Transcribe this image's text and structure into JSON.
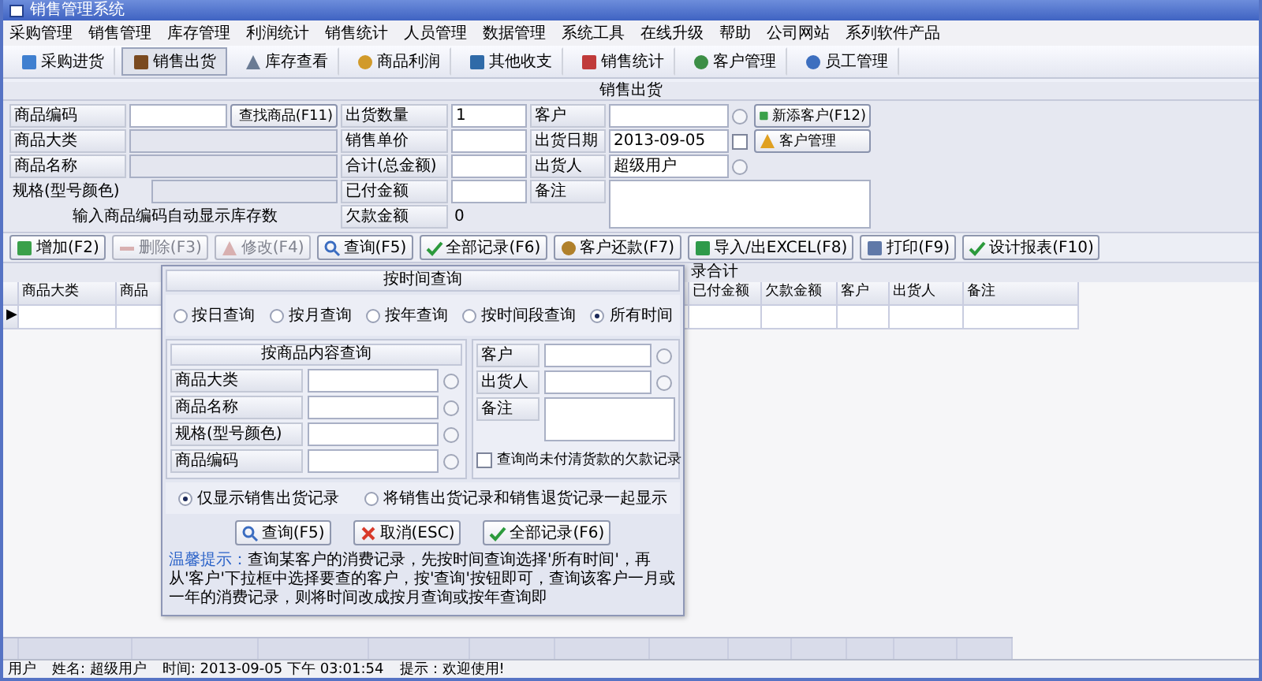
{
  "window": {
    "title": "销售管理系统"
  },
  "menu": [
    "采购管理",
    "销售管理",
    "库存管理",
    "利润统计",
    "销售统计",
    "人员管理",
    "数据管理",
    "系统工具",
    "在线升级",
    "帮助",
    "公司网站",
    "系列软件产品"
  ],
  "toolbar": [
    {
      "label": "采购进货",
      "selected": false
    },
    {
      "label": "销售出货",
      "selected": true
    },
    {
      "label": "库存查看",
      "selected": false
    },
    {
      "label": "商品利润",
      "selected": false
    },
    {
      "label": "其他收支",
      "selected": false
    },
    {
      "label": "销售统计",
      "selected": false
    },
    {
      "label": "客户管理",
      "selected": false
    },
    {
      "label": "员工管理",
      "selected": false
    }
  ],
  "section_title": "销售出货",
  "form": {
    "code_label": "商品编码",
    "find_button": "查找商品(F11)",
    "category_label": "商品大类",
    "name_label": "商品名称",
    "spec_label": "规格(型号颜色)",
    "stock_hint": "输入商品编码自动显示库存数",
    "qty_label": "出货数量",
    "qty_value": "1",
    "price_label": "销售单价",
    "total_label": "合计(总金额)",
    "paid_label": "已付金额",
    "owed_label": "欠款金额",
    "owed_value": "0",
    "customer_label": "客户",
    "date_label": "出货日期",
    "date_value": "2013-09-05",
    "date_checked": false,
    "seller_label": "出货人",
    "seller_value": "超级用户",
    "note_label": "备注",
    "new_customer_button": "新添客户(F12)",
    "customer_manage_button": "客户管理"
  },
  "actions": [
    {
      "label": "增加(F2)",
      "disabled": false
    },
    {
      "label": "删除(F3)",
      "disabled": true
    },
    {
      "label": "修改(F4)",
      "disabled": true
    },
    {
      "label": "查询(F5)",
      "disabled": false
    },
    {
      "label": "全部记录(F6)",
      "disabled": false
    },
    {
      "label": "客户还款(F7)",
      "disabled": false
    },
    {
      "label": "导入/出EXCEL(F8)",
      "disabled": false
    },
    {
      "label": "打印(F9)",
      "disabled": false
    },
    {
      "label": "设计报表(F10)",
      "disabled": false
    }
  ],
  "grid": {
    "caption": "录合计",
    "current_row_marker": "▶",
    "columns": [
      "商品大类",
      "商品",
      "已付金额",
      "欠款金额",
      "客户",
      "出货人",
      "备注"
    ]
  },
  "dialog": {
    "time_title": "按时间查询",
    "time_options": [
      {
        "label": "按日查询",
        "selected": false
      },
      {
        "label": "按月查询",
        "selected": false
      },
      {
        "label": "按年查询",
        "selected": false
      },
      {
        "label": "按时间段查询",
        "selected": false
      },
      {
        "label": "所有时间",
        "selected": true
      }
    ],
    "content_title": "按商品内容查询",
    "content_fields": [
      "商品大类",
      "商品名称",
      "规格(型号颜色)",
      "商品编码"
    ],
    "side_fields": [
      "客户",
      "出货人"
    ],
    "note_label": "备注",
    "unpaid_only": {
      "label": "查询尚未付清货款的欠款记录",
      "checked": false
    },
    "record_options": [
      {
        "label": "仅显示销售出货记录",
        "selected": true
      },
      {
        "label": "将销售出货记录和销售退货记录一起显示",
        "selected": false
      }
    ],
    "buttons": [
      "查询(F5)",
      "取消(ESC)",
      "全部记录(F6)"
    ],
    "tip_label": "温馨提示：",
    "tip_text": "查询某客户的消费记录，先按时间查询选择'所有时间'，再从'客户'下拉框中选择要查的客户，按'查询'按钮即可，查询该客户一月或一年的消费记录，则将时间改成按月查询或按年查询即"
  },
  "status_bar": [
    "用户",
    "姓名: 超级用户",
    "时间: 2013-09-05 下午 03:01:54",
    "提示：欢迎使用!"
  ]
}
